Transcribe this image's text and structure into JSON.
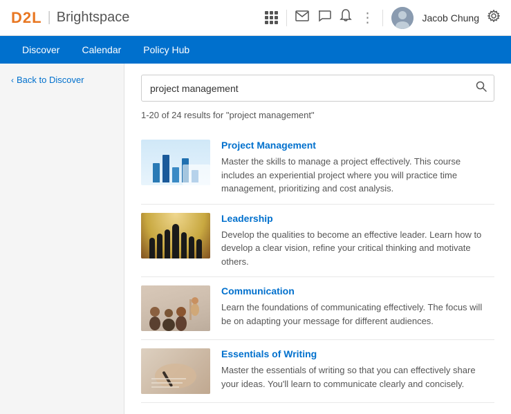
{
  "header": {
    "logo_d2l": "D2L",
    "logo_separator": "|",
    "logo_brightspace": "Brightspace",
    "username": "Jacob Chung",
    "icons": {
      "grid": "⊞",
      "mail": "✉",
      "chat": "💬",
      "bell": "🔔",
      "more": "⋮",
      "gear": "⚙"
    }
  },
  "navbar": {
    "items": [
      {
        "id": "discover",
        "label": "Discover"
      },
      {
        "id": "calendar",
        "label": "Calendar"
      },
      {
        "id": "policy-hub",
        "label": "Policy Hub"
      }
    ]
  },
  "sidebar": {
    "back_arrow": "‹",
    "back_label": "Back to Discover"
  },
  "search": {
    "value": "project management",
    "placeholder": "Search...",
    "icon": "🔍"
  },
  "results": {
    "summary_start": "1-20 of 24 results for ",
    "query_display": "\"project management\"",
    "items": [
      {
        "id": "project-management",
        "title": "Project Management",
        "description": "Master the skills to manage a project effectively. This course includes an experiential project where you will practice time management, prioritizing and cost analysis."
      },
      {
        "id": "leadership",
        "title": "Leadership",
        "description": "Develop the qualities to become an effective leader. Learn how to develop a clear vision, refine your critical thinking and motivate others."
      },
      {
        "id": "communication",
        "title": "Communication",
        "description": "Learn the foundations of communicating effectively. The focus will be on adapting your message for different audiences."
      },
      {
        "id": "essentials-of-writing",
        "title": "Essentials of Writing",
        "description": "Master the essentials of writing so that you can effectively share your ideas.  You'll learn to communicate clearly and concisely."
      }
    ]
  }
}
